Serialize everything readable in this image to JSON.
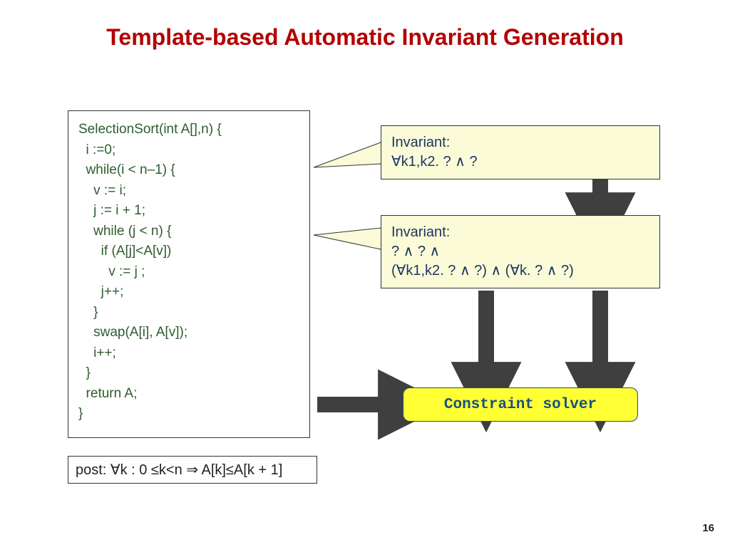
{
  "title": "Template-based Automatic Invariant Generation",
  "code": "SelectionSort(int A[],n) {\n  i :=0;\n  while(i < n–1) {\n    v := i;\n    j := i + 1;\n    while (j < n) {\n      if (A[j]<A[v])\n        v := j ;\n      j++;\n    }\n    swap(A[i], A[v]);\n    i++;\n  }\n  return A;\n}",
  "post": "post:  ∀k : 0 ≤k<n ⇒ A[k]≤A[k + 1]",
  "inv1_l1": "Invariant:",
  "inv1_l2": "∀k1,k2. ? ∧ ?",
  "inv2_l1": "Invariant:",
  "inv2_l2": "? ∧ ? ∧",
  "inv2_l3": "(∀k1,k2. ? ∧ ?) ∧ (∀k. ? ∧ ?)",
  "solver": "Constraint solver",
  "page": "16"
}
